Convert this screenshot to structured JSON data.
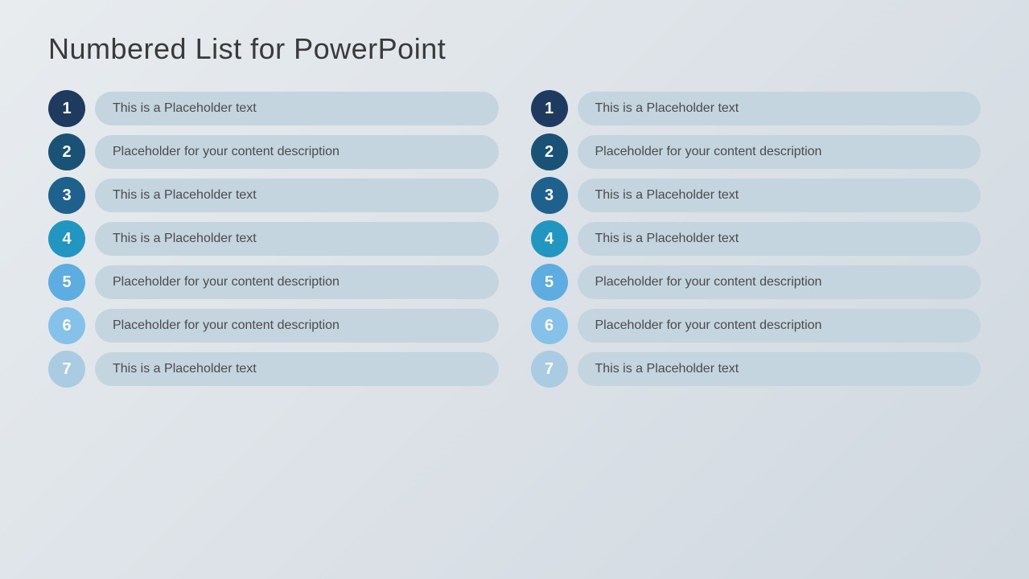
{
  "title": "Numbered List for PowerPoint",
  "left_column": {
    "items": [
      {
        "number": "1",
        "text": "This is a Placeholder text",
        "circle_class": "circle-1"
      },
      {
        "number": "2",
        "text": "Placeholder for your content description",
        "circle_class": "circle-2"
      },
      {
        "number": "3",
        "text": "This is a Placeholder text",
        "circle_class": "circle-3"
      },
      {
        "number": "4",
        "text": "This is a Placeholder text",
        "circle_class": "circle-4"
      },
      {
        "number": "5",
        "text": "Placeholder for your content description",
        "circle_class": "circle-5"
      },
      {
        "number": "6",
        "text": "Placeholder for your content description",
        "circle_class": "circle-6"
      },
      {
        "number": "7",
        "text": "This is a Placeholder text",
        "circle_class": "circle-7"
      }
    ]
  },
  "right_column": {
    "items": [
      {
        "number": "1",
        "text": "This is a Placeholder text",
        "circle_class": "circle-1"
      },
      {
        "number": "2",
        "text": "Placeholder for your content description",
        "circle_class": "circle-2"
      },
      {
        "number": "3",
        "text": "This is a Placeholder text",
        "circle_class": "circle-3"
      },
      {
        "number": "4",
        "text": "This is a Placeholder text",
        "circle_class": "circle-4"
      },
      {
        "number": "5",
        "text": "Placeholder for your content description",
        "circle_class": "circle-5"
      },
      {
        "number": "6",
        "text": "Placeholder for your content description",
        "circle_class": "circle-6"
      },
      {
        "number": "7",
        "text": "This is a Placeholder text",
        "circle_class": "circle-7"
      }
    ]
  }
}
